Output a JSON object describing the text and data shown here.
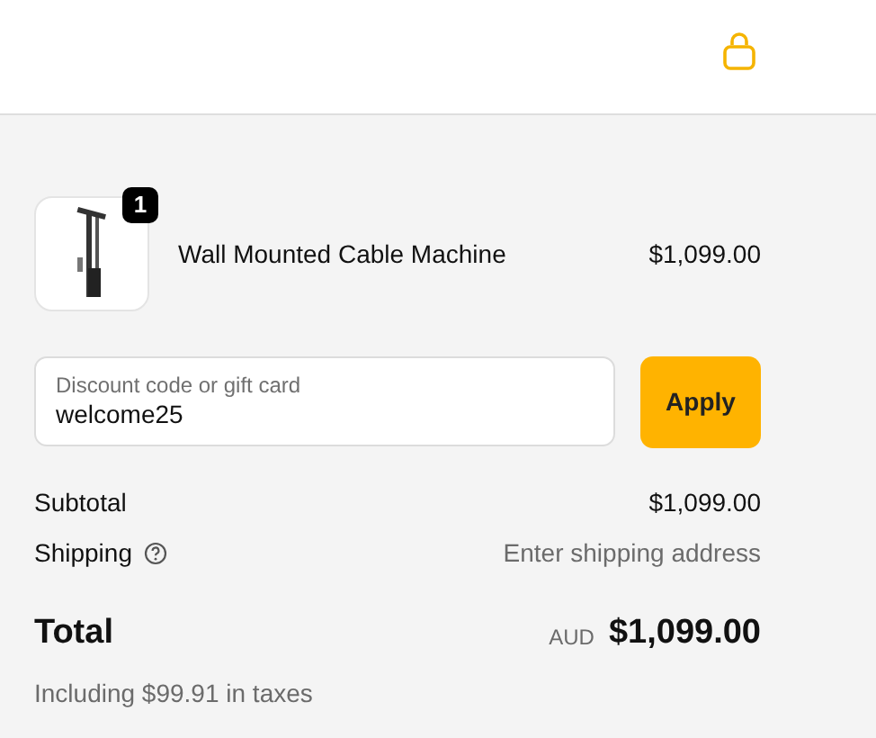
{
  "cart_item": {
    "quantity": "1",
    "name": "Wall Mounted Cable Machine",
    "price": "$1,099.00"
  },
  "discount": {
    "placeholder": "Discount code or gift card",
    "value": "welcome25",
    "button": "Apply"
  },
  "summary": [
    {
      "label": "Subtotal",
      "value": "$1,099.00",
      "kind": "amount"
    },
    {
      "label": "Shipping",
      "value": "Enter shipping address",
      "kind": "hint"
    }
  ],
  "total": {
    "label": "Total",
    "currency": "AUD",
    "amount": "$1,099.00",
    "taxes": "Including $99.91 in taxes"
  }
}
